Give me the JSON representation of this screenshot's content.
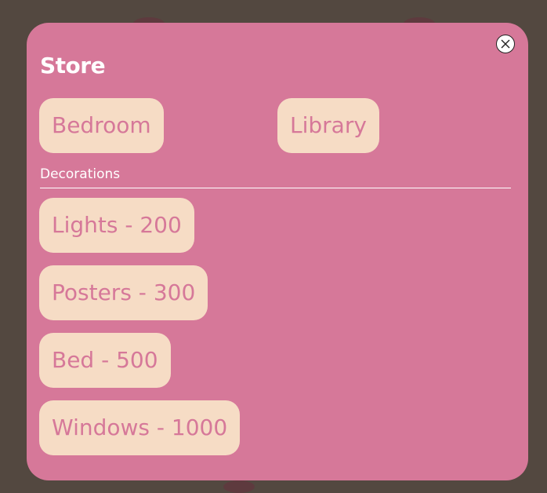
{
  "store": {
    "title": "Store",
    "rooms": [
      "Bedroom",
      "Library"
    ],
    "section_label": "Decorations",
    "items": [
      "Lights - 200",
      "Posters - 300",
      "Bed - 500",
      "Windows - 1000"
    ],
    "close_icon": "close-icon"
  },
  "colors": {
    "background": "#534840",
    "panel": "#d67899",
    "button": "#f6dcc5",
    "button_text": "#d67899"
  }
}
